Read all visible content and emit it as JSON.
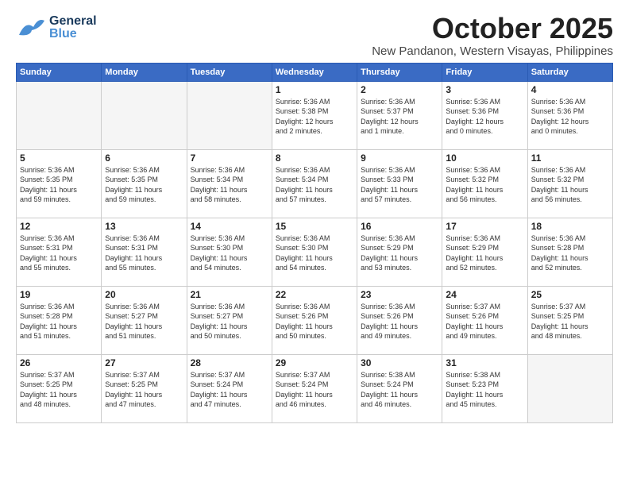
{
  "header": {
    "logo_general": "General",
    "logo_blue": "Blue",
    "month": "October 2025",
    "location": "New Pandanon, Western Visayas, Philippines"
  },
  "weekdays": [
    "Sunday",
    "Monday",
    "Tuesday",
    "Wednesday",
    "Thursday",
    "Friday",
    "Saturday"
  ],
  "weeks": [
    [
      {
        "day": "",
        "info": ""
      },
      {
        "day": "",
        "info": ""
      },
      {
        "day": "",
        "info": ""
      },
      {
        "day": "1",
        "info": "Sunrise: 5:36 AM\nSunset: 5:38 PM\nDaylight: 12 hours\nand 2 minutes."
      },
      {
        "day": "2",
        "info": "Sunrise: 5:36 AM\nSunset: 5:37 PM\nDaylight: 12 hours\nand 1 minute."
      },
      {
        "day": "3",
        "info": "Sunrise: 5:36 AM\nSunset: 5:36 PM\nDaylight: 12 hours\nand 0 minutes."
      },
      {
        "day": "4",
        "info": "Sunrise: 5:36 AM\nSunset: 5:36 PM\nDaylight: 12 hours\nand 0 minutes."
      }
    ],
    [
      {
        "day": "5",
        "info": "Sunrise: 5:36 AM\nSunset: 5:35 PM\nDaylight: 11 hours\nand 59 minutes."
      },
      {
        "day": "6",
        "info": "Sunrise: 5:36 AM\nSunset: 5:35 PM\nDaylight: 11 hours\nand 59 minutes."
      },
      {
        "day": "7",
        "info": "Sunrise: 5:36 AM\nSunset: 5:34 PM\nDaylight: 11 hours\nand 58 minutes."
      },
      {
        "day": "8",
        "info": "Sunrise: 5:36 AM\nSunset: 5:34 PM\nDaylight: 11 hours\nand 57 minutes."
      },
      {
        "day": "9",
        "info": "Sunrise: 5:36 AM\nSunset: 5:33 PM\nDaylight: 11 hours\nand 57 minutes."
      },
      {
        "day": "10",
        "info": "Sunrise: 5:36 AM\nSunset: 5:32 PM\nDaylight: 11 hours\nand 56 minutes."
      },
      {
        "day": "11",
        "info": "Sunrise: 5:36 AM\nSunset: 5:32 PM\nDaylight: 11 hours\nand 56 minutes."
      }
    ],
    [
      {
        "day": "12",
        "info": "Sunrise: 5:36 AM\nSunset: 5:31 PM\nDaylight: 11 hours\nand 55 minutes."
      },
      {
        "day": "13",
        "info": "Sunrise: 5:36 AM\nSunset: 5:31 PM\nDaylight: 11 hours\nand 55 minutes."
      },
      {
        "day": "14",
        "info": "Sunrise: 5:36 AM\nSunset: 5:30 PM\nDaylight: 11 hours\nand 54 minutes."
      },
      {
        "day": "15",
        "info": "Sunrise: 5:36 AM\nSunset: 5:30 PM\nDaylight: 11 hours\nand 54 minutes."
      },
      {
        "day": "16",
        "info": "Sunrise: 5:36 AM\nSunset: 5:29 PM\nDaylight: 11 hours\nand 53 minutes."
      },
      {
        "day": "17",
        "info": "Sunrise: 5:36 AM\nSunset: 5:29 PM\nDaylight: 11 hours\nand 52 minutes."
      },
      {
        "day": "18",
        "info": "Sunrise: 5:36 AM\nSunset: 5:28 PM\nDaylight: 11 hours\nand 52 minutes."
      }
    ],
    [
      {
        "day": "19",
        "info": "Sunrise: 5:36 AM\nSunset: 5:28 PM\nDaylight: 11 hours\nand 51 minutes."
      },
      {
        "day": "20",
        "info": "Sunrise: 5:36 AM\nSunset: 5:27 PM\nDaylight: 11 hours\nand 51 minutes."
      },
      {
        "day": "21",
        "info": "Sunrise: 5:36 AM\nSunset: 5:27 PM\nDaylight: 11 hours\nand 50 minutes."
      },
      {
        "day": "22",
        "info": "Sunrise: 5:36 AM\nSunset: 5:26 PM\nDaylight: 11 hours\nand 50 minutes."
      },
      {
        "day": "23",
        "info": "Sunrise: 5:36 AM\nSunset: 5:26 PM\nDaylight: 11 hours\nand 49 minutes."
      },
      {
        "day": "24",
        "info": "Sunrise: 5:37 AM\nSunset: 5:26 PM\nDaylight: 11 hours\nand 49 minutes."
      },
      {
        "day": "25",
        "info": "Sunrise: 5:37 AM\nSunset: 5:25 PM\nDaylight: 11 hours\nand 48 minutes."
      }
    ],
    [
      {
        "day": "26",
        "info": "Sunrise: 5:37 AM\nSunset: 5:25 PM\nDaylight: 11 hours\nand 48 minutes."
      },
      {
        "day": "27",
        "info": "Sunrise: 5:37 AM\nSunset: 5:25 PM\nDaylight: 11 hours\nand 47 minutes."
      },
      {
        "day": "28",
        "info": "Sunrise: 5:37 AM\nSunset: 5:24 PM\nDaylight: 11 hours\nand 47 minutes."
      },
      {
        "day": "29",
        "info": "Sunrise: 5:37 AM\nSunset: 5:24 PM\nDaylight: 11 hours\nand 46 minutes."
      },
      {
        "day": "30",
        "info": "Sunrise: 5:38 AM\nSunset: 5:24 PM\nDaylight: 11 hours\nand 46 minutes."
      },
      {
        "day": "31",
        "info": "Sunrise: 5:38 AM\nSunset: 5:23 PM\nDaylight: 11 hours\nand 45 minutes."
      },
      {
        "day": "",
        "info": ""
      }
    ]
  ]
}
